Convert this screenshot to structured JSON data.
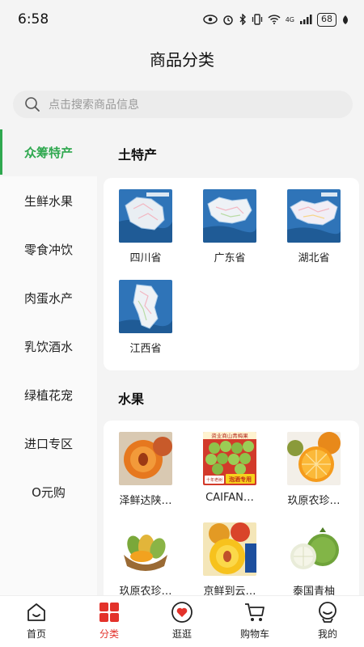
{
  "status": {
    "time": "6:58",
    "network": "4G",
    "battery": "68"
  },
  "header": {
    "title": "商品分类"
  },
  "search": {
    "placeholder": "点击搜索商品信息"
  },
  "sidebar": {
    "items": [
      {
        "label": "众筹特产",
        "active": true
      },
      {
        "label": "生鲜水果",
        "active": false
      },
      {
        "label": "零食冲饮",
        "active": false
      },
      {
        "label": "肉蛋水产",
        "active": false
      },
      {
        "label": "乳饮酒水",
        "active": false
      },
      {
        "label": "绿植花宠",
        "active": false
      },
      {
        "label": "进口专区",
        "active": false
      },
      {
        "label": "O元购",
        "active": false
      }
    ]
  },
  "sections": [
    {
      "title": "土特产",
      "items": [
        {
          "label": "四川省",
          "image": "sichuan-map"
        },
        {
          "label": "广东省",
          "image": "guangdong-map"
        },
        {
          "label": "湖北省",
          "image": "hubei-map"
        },
        {
          "label": "江西省",
          "image": "jiangxi-map"
        }
      ]
    },
    {
      "title": "水果",
      "items": [
        {
          "label": "泽鲜达陕…",
          "image": "peach-photo"
        },
        {
          "label": "CAIFAN…",
          "image": "green-plum-photo",
          "image_texts": [
            "资业商山青梅果",
            "十年老树",
            "泡酒专用"
          ]
        },
        {
          "label": "玖原农珍…",
          "image": "orange-photo"
        },
        {
          "label": "玖原农珍…",
          "image": "mango-photo"
        },
        {
          "label": "京鲜到云…",
          "image": "yellow-peach-photo"
        },
        {
          "label": "泰国青柚",
          "image": "pomelo-photo"
        }
      ]
    }
  ],
  "tabbar": {
    "items": [
      {
        "label": "首页",
        "icon": "home-icon",
        "active": false
      },
      {
        "label": "分类",
        "icon": "category-icon",
        "active": true
      },
      {
        "label": "逛逛",
        "icon": "browse-heart-icon",
        "active": false
      },
      {
        "label": "购物车",
        "icon": "cart-icon",
        "active": false
      },
      {
        "label": "我的",
        "icon": "profile-icon",
        "active": false
      }
    ]
  },
  "colors": {
    "accent_green": "#2fa84f",
    "accent_red": "#e3322b",
    "map_sea": "#2f74b8"
  }
}
